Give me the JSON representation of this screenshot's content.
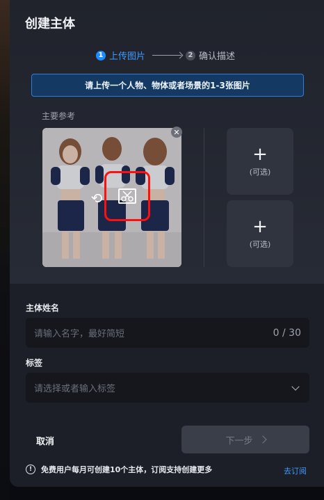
{
  "dialog": {
    "title": "创建主体"
  },
  "steps": [
    {
      "num": "1",
      "label": "上传图片"
    },
    {
      "num": "2",
      "label": "确认描述"
    }
  ],
  "notice": "请上传一个人物、物体或者场景的1-3张图片",
  "reference": {
    "label": "主要参考"
  },
  "slots": [
    {
      "label": "(可选)"
    },
    {
      "label": "(可选)"
    }
  ],
  "name_field": {
    "label": "主体姓名",
    "placeholder": "请输入名字，最好简短",
    "counter": "0 / 30"
  },
  "tags_field": {
    "label": "标签",
    "placeholder": "请选择或者输入标签"
  },
  "actions": {
    "cancel": "取消",
    "next": "下一步"
  },
  "footer": {
    "info_text": "免费用户每月可创建10个主体，订阅支持创建更多",
    "link": "去订阅"
  },
  "icons": {
    "step_arrow": "arrow-right-icon",
    "close": "close-icon",
    "swap": "swap-icon",
    "crop": "crop-icon",
    "add": "plus-icon",
    "dropdown": "chevron-down-icon",
    "info": "info-icon"
  },
  "colors": {
    "accent": "#1e8cff",
    "highlight": "#ff1010",
    "modal_bg": "#1c1f27"
  }
}
